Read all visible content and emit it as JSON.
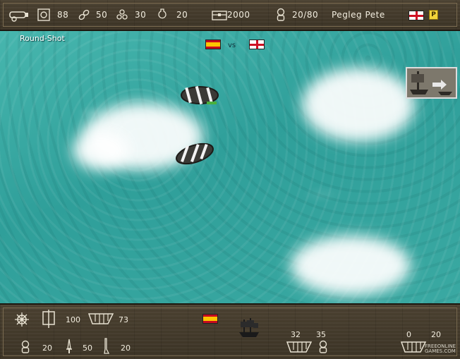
{
  "top_bar": {
    "cannonballs": "88",
    "chainshot": "50",
    "grapeshot": "30",
    "powder": "20",
    "gold": "2000",
    "crew": "20/80",
    "captain_name": "Pegleg Pete",
    "player_flag": "england",
    "pause_label": "P"
  },
  "battle": {
    "ammo_type": "Round-Shot",
    "vs_label": "vs",
    "enemy_flag": "spain",
    "player_flag": "england"
  },
  "enemy_panel": {
    "sails": "100",
    "hull": "73",
    "crew": "20",
    "swords": "50",
    "muskets": "20",
    "flag": "spain",
    "cannon_group_1_top": "32",
    "crew_group_1_top": "35",
    "cannon_group_2_top": "0",
    "crew_group_2_top": "20"
  },
  "watermark": {
    "line1": "FREEONLINE",
    "line2": "GAMES.COM"
  },
  "colors": {
    "sea": "#3aa9a2",
    "wood": "#4a4030",
    "text": "#f3eee0"
  }
}
